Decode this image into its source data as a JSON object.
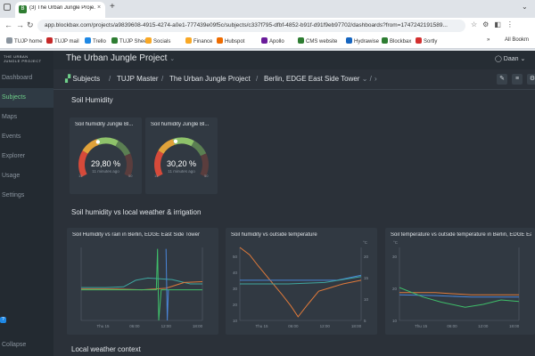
{
  "browser": {
    "tab_title": "(3) The Urban Jungle Proje...",
    "tab_close": "×",
    "new_tab": "+",
    "url": "app.blockbax.com/projects/a9839608-4915-4274-a0e1-777439e09f5c/subjects/c337f795-dfbf-4852-b91f-d91f9eb97702/dashboards?from=1747242191589...",
    "bookmarks": [
      "TUJP home",
      "TUJP mail",
      "Trello",
      "TUJP Sheets",
      "Socials",
      "Finance",
      "Hubspot",
      "Apollo",
      "CMS website",
      "Hydrawise",
      "Blockbax",
      "Sortly"
    ],
    "all_bookmarks": "All Bookm",
    "more": "»"
  },
  "sidebar": {
    "logo_lines": [
      "THE URBAN",
      "JUNGLE PROJECT"
    ],
    "items": [
      {
        "label": "Dashboard",
        "active": false
      },
      {
        "label": "Subjects",
        "active": true
      },
      {
        "label": "Maps",
        "active": false
      },
      {
        "label": "Events",
        "active": false
      },
      {
        "label": "Explorer",
        "active": false
      },
      {
        "label": "Usage",
        "active": false
      },
      {
        "label": "Settings",
        "active": false
      }
    ],
    "collapse": "Collapse"
  },
  "header": {
    "title": "The Urban Jungle Project",
    "user": "Daan"
  },
  "breadcrumb": {
    "subjects": "Subjects",
    "master": "TUJP Master",
    "project": "The Urban Jungle Project",
    "location": "Berlin, EDGE East Side Tower"
  },
  "sections": {
    "soil_humidity": "Soil Humidity",
    "weather": "Soil humidity vs local weather & irrigation",
    "local_weather": "Local weather context"
  },
  "gauges": [
    {
      "title": "Soil humidity Jungle Bl...",
      "value": "29,80 %",
      "sub": "11 minutes ago",
      "min": "15",
      "max": "50",
      "level": 0.42
    },
    {
      "title": "Soil humidity Jungle Bl...",
      "value": "30,20 %",
      "sub": "11 minutes ago",
      "min": "15",
      "max": "50",
      "level": 0.44
    }
  ],
  "charts": [
    {
      "title": "Soil Humidity vs rain in Berlin, EDGE East Side Tower",
      "xticks": [
        "Thu 15",
        "06:00",
        "12:00",
        "18:00"
      ]
    },
    {
      "title": "Soil humidity vs outside temperature",
      "xticks": [
        "Thu 15",
        "06:00",
        "12:00",
        "18:00"
      ],
      "y_unit_right": "°C",
      "y_left": [
        "50",
        "40",
        "30",
        "20",
        "10"
      ],
      "y_right": [
        "20",
        "15",
        "10",
        "5"
      ]
    },
    {
      "title": "Soil temperature vs outside temperature in Berlin, EDGE East Side Tower",
      "xticks": [
        "Thu 15",
        "06:00",
        "12:00",
        "18:00"
      ],
      "y_unit_left": "°C",
      "y_left": [
        "30",
        "20",
        "10"
      ]
    }
  ],
  "colors": {
    "accent_green": "#6fd08a",
    "humidity_series": "#3fa7a0",
    "rain_series": "#3fbf6a",
    "temp_series": "#e07a3a",
    "soil_temp_series": "#4a86d9"
  }
}
